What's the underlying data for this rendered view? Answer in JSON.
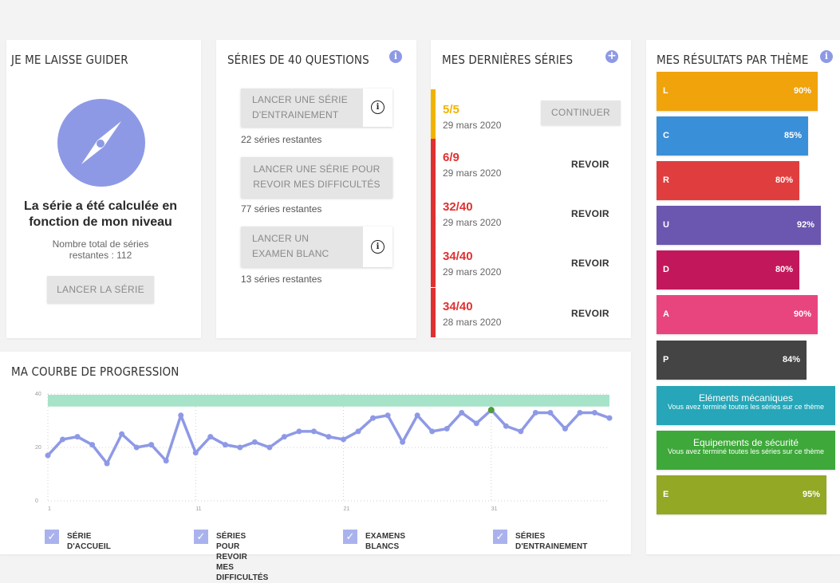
{
  "guide": {
    "title": "JE ME LAISSE GUIDER",
    "headline_line1": "La série a été calculée en",
    "headline_line2": "fonction de mon niveau",
    "total_line1": "Nombre total de séries",
    "total_line2": "restantes : 112",
    "button": "LANCER LA SÉRIE",
    "icon": "compass-icon"
  },
  "series40": {
    "title": "SÉRIES DE 40 QUESTIONS",
    "buttons": [
      {
        "line1": "LANCER UNE SÉRIE",
        "line2": "D'ENTRAINEMENT",
        "remaining": "22 séries restantes",
        "has_info": true
      },
      {
        "line1": "LANCER UNE SÉRIE POUR",
        "line2": "REVOIR MES DIFFICULTÉS",
        "remaining": "77 séries restantes",
        "has_info": false
      },
      {
        "line1": "LANCER UN",
        "line2": "EXAMEN BLANC",
        "remaining": "13 séries restantes",
        "has_info": true
      }
    ]
  },
  "last_series": {
    "title": "MES DERNIÈRES SÉRIES",
    "rows": [
      {
        "score": "5/5",
        "date": "29 mars 2020",
        "action": "CONTINUER",
        "color": "#f0b400"
      },
      {
        "score": "6/9",
        "date": "29 mars 2020",
        "action": "REVOIR",
        "color": "#e03131"
      },
      {
        "score": "32/40",
        "date": "29 mars 2020",
        "action": "REVOIR",
        "color": "#e03131"
      },
      {
        "score": "34/40",
        "date": "29 mars 2020",
        "action": "REVOIR",
        "color": "#e03131"
      },
      {
        "score": "34/40",
        "date": "28 mars 2020",
        "action": "REVOIR",
        "color": "#e03131"
      }
    ]
  },
  "themes": {
    "title": "MES RÉSULTATS PAR THÈME",
    "bars": [
      {
        "letter": "L",
        "pct": "90%",
        "value": 90,
        "color": "#f0a30a"
      },
      {
        "letter": "C",
        "pct": "85%",
        "value": 85,
        "color": "#3a8fd9"
      },
      {
        "letter": "R",
        "pct": "80%",
        "value": 80,
        "color": "#e03e3e"
      },
      {
        "letter": "U",
        "pct": "92%",
        "value": 92,
        "color": "#6b56b0"
      },
      {
        "letter": "D",
        "pct": "80%",
        "value": 80,
        "color": "#c2185b"
      },
      {
        "letter": "A",
        "pct": "90%",
        "value": 90,
        "color": "#e8457f"
      },
      {
        "letter": "P",
        "pct": "84%",
        "value": 84,
        "color": "#444444"
      }
    ],
    "done": [
      {
        "name": "Eléments mécaniques",
        "msg": "Vous avez terminé toutes les séries sur ce thème",
        "color": "#26a6b8"
      },
      {
        "name": "Equipements de sécurité",
        "msg": "Vous avez terminé toutes les séries sur ce thème",
        "color": "#3ea83a"
      }
    ],
    "last_bar": {
      "letter": "E",
      "pct": "95%",
      "value": 95,
      "color": "#93a825"
    }
  },
  "progression": {
    "title": "MA COURBE DE PROGRESSION",
    "legend": [
      {
        "line1": "SÉRIE D'ACCUEIL",
        "line2": ""
      },
      {
        "line1": "SÉRIES POUR REVOIR",
        "line2": "MES DIFFICULTÉS"
      },
      {
        "line1": "EXAMENS BLANCS",
        "line2": ""
      },
      {
        "line1": "SÉRIES",
        "line2": "D'ENTRAINEMENT"
      }
    ]
  },
  "chart_data": {
    "type": "line",
    "title": "MA COURBE DE PROGRESSION",
    "xlabel": "",
    "ylabel": "",
    "ylim": [
      0,
      40
    ],
    "xlim": [
      1,
      37
    ],
    "yticks": [
      0,
      20,
      40
    ],
    "xticks": [
      1,
      11,
      21,
      31
    ],
    "band": {
      "from": 35,
      "to": 40,
      "color": "#a6e3c8"
    },
    "highlight_index": 30,
    "series": [
      {
        "values": [
          17,
          23,
          24,
          21,
          14,
          25,
          20,
          21,
          15,
          32,
          18,
          24,
          21,
          20,
          22,
          20,
          24,
          26,
          26,
          24,
          23,
          26,
          31,
          32,
          22,
          32,
          26,
          27,
          33,
          29,
          34,
          28,
          26,
          33,
          33,
          27,
          33,
          33,
          31
        ],
        "color": "#8e99e6"
      }
    ]
  }
}
